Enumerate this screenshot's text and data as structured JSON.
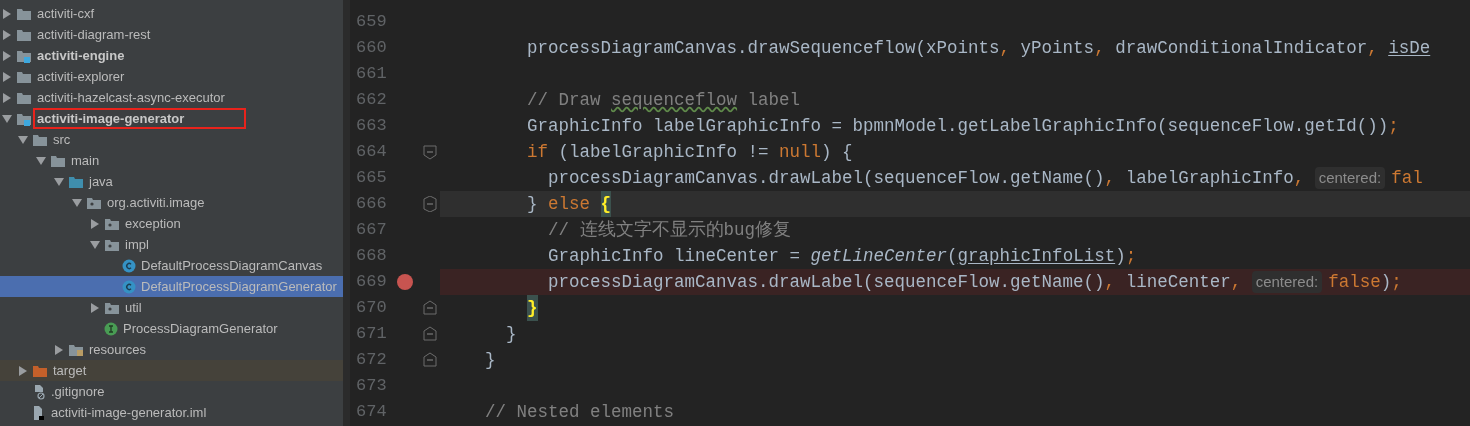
{
  "project_tree": [
    {
      "label": "activiti-cxf",
      "kind": "folder",
      "bold": false,
      "expanded": false
    },
    {
      "label": "activiti-diagram-rest",
      "kind": "folder",
      "bold": false,
      "expanded": false
    },
    {
      "label": "activiti-engine",
      "kind": "module",
      "bold": true,
      "expanded": false
    },
    {
      "label": "activiti-explorer",
      "kind": "folder",
      "bold": false,
      "expanded": false
    },
    {
      "label": "activiti-hazelcast-async-executor",
      "kind": "folder",
      "bold": false,
      "expanded": false
    },
    {
      "label": "activiti-image-generator",
      "kind": "module",
      "bold": true,
      "expanded": true,
      "annotated": true,
      "children": [
        {
          "label": "src",
          "kind": "folder",
          "expanded": true,
          "children": [
            {
              "label": "main",
              "kind": "folder",
              "expanded": true,
              "children": [
                {
                  "label": "java",
                  "kind": "source",
                  "expanded": true,
                  "children": [
                    {
                      "label": "org.activiti.image",
                      "kind": "package",
                      "expanded": true,
                      "children": [
                        {
                          "label": "exception",
                          "kind": "package",
                          "expanded": false
                        },
                        {
                          "label": "impl",
                          "kind": "package",
                          "expanded": true,
                          "children": [
                            {
                              "label": "DefaultProcessDiagramCanvas",
                              "kind": "class",
                              "selected": false
                            },
                            {
                              "label": "DefaultProcessDiagramGenerator",
                              "kind": "class",
                              "selected": true
                            }
                          ]
                        },
                        {
                          "label": "util",
                          "kind": "package",
                          "expanded": false
                        },
                        {
                          "label": "ProcessDiagramGenerator",
                          "kind": "interface",
                          "selected": false
                        }
                      ]
                    }
                  ]
                },
                {
                  "label": "resources",
                  "kind": "resources",
                  "expanded": false
                }
              ]
            }
          ]
        },
        {
          "label": "target",
          "kind": "excluded",
          "expanded": false
        },
        {
          "label": ".gitignore",
          "kind": "ignore-file",
          "selected": false
        },
        {
          "label": "activiti-image-generator.iml",
          "kind": "iml-file",
          "selected": false
        }
      ]
    }
  ],
  "editor": {
    "lines": [
      {
        "number": "659"
      },
      {
        "number": "660",
        "tokens": [
          {
            "text": "    processDiagramCanvas.drawSequenceflow(xPoints",
            "kind": "code"
          },
          {
            "text": ", ",
            "kind": "punct"
          },
          {
            "text": "yPoints",
            "kind": "code"
          },
          {
            "text": ", ",
            "kind": "punct"
          },
          {
            "text": "drawConditionalIndicator",
            "kind": "code"
          },
          {
            "text": ", ",
            "kind": "punct"
          },
          {
            "text": "isDe",
            "kind": "underlined"
          }
        ]
      },
      {
        "number": "661"
      },
      {
        "number": "662",
        "tokens": [
          {
            "text": "    // Draw ",
            "kind": "comment"
          },
          {
            "text": "sequenceflow",
            "kind": "typo"
          },
          {
            "text": " label",
            "kind": "comment"
          }
        ]
      },
      {
        "number": "663",
        "tokens": [
          {
            "text": "    GraphicInfo labelGraphicInfo = bpmnModel.getLabelGraphicInfo(sequenceFlow.getId())",
            "kind": "code"
          },
          {
            "text": ";",
            "kind": "punct"
          }
        ]
      },
      {
        "number": "664",
        "fold_start": true,
        "tokens": [
          {
            "text": "    if ",
            "kind": "keyword"
          },
          {
            "text": "(labelGraphicInfo != ",
            "kind": "code"
          },
          {
            "text": "null",
            "kind": "keyword"
          },
          {
            "text": ") {",
            "kind": "code"
          }
        ]
      },
      {
        "number": "665",
        "tokens": [
          {
            "text": "      processDiagramCanvas.drawLabel(sequenceFlow.getName()",
            "kind": "code"
          },
          {
            "text": ", ",
            "kind": "punct"
          },
          {
            "text": "labelGraphicInfo",
            "kind": "code"
          },
          {
            "text": ", ",
            "kind": "punct"
          },
          {
            "text": "centered:",
            "kind": "hint"
          },
          {
            "text": "fal",
            "kind": "keyword"
          }
        ]
      },
      {
        "number": "666",
        "fold_start": true,
        "fold_end": true,
        "current": true,
        "tokens": [
          {
            "text": "    } ",
            "kind": "code"
          },
          {
            "text": "else ",
            "kind": "keyword"
          },
          {
            "text": "{",
            "kind": "brace-match"
          }
        ]
      },
      {
        "number": "667",
        "tokens": [
          {
            "text": "      // 连线文字不显示的bug修复",
            "kind": "comment"
          }
        ]
      },
      {
        "number": "668",
        "tokens": [
          {
            "text": "      GraphicInfo lineCenter = ",
            "kind": "code"
          },
          {
            "text": "getLineCenter",
            "kind": "static"
          },
          {
            "text": "(",
            "kind": "code"
          },
          {
            "text": "graphicInfoList",
            "kind": "underlined"
          },
          {
            "text": ")",
            "kind": "code"
          },
          {
            "text": ";",
            "kind": "punct"
          }
        ]
      },
      {
        "number": "669",
        "breakpoint": true,
        "tokens": [
          {
            "text": "      processDiagramCanvas.drawLabel(sequenceFlow.getName()",
            "kind": "code"
          },
          {
            "text": ", ",
            "kind": "punct"
          },
          {
            "text": "lineCenter",
            "kind": "code"
          },
          {
            "text": ", ",
            "kind": "punct"
          },
          {
            "text": "centered:",
            "kind": "hint"
          },
          {
            "text": "false",
            "kind": "keyword"
          },
          {
            "text": ")",
            "kind": "code"
          },
          {
            "text": ";",
            "kind": "punct"
          }
        ]
      },
      {
        "number": "670",
        "fold_end": true,
        "tokens": [
          {
            "text": "    }",
            "kind": "brace-match"
          }
        ]
      },
      {
        "number": "671",
        "fold_end": true,
        "tokens": [
          {
            "text": "  }",
            "kind": "code"
          }
        ]
      },
      {
        "number": "672",
        "fold_end": true,
        "tokens": [
          {
            "text": "}",
            "kind": "code"
          }
        ]
      },
      {
        "number": "673"
      },
      {
        "number": "674",
        "tokens": [
          {
            "text": "// Nested elements",
            "kind": "comment"
          }
        ]
      }
    ]
  }
}
